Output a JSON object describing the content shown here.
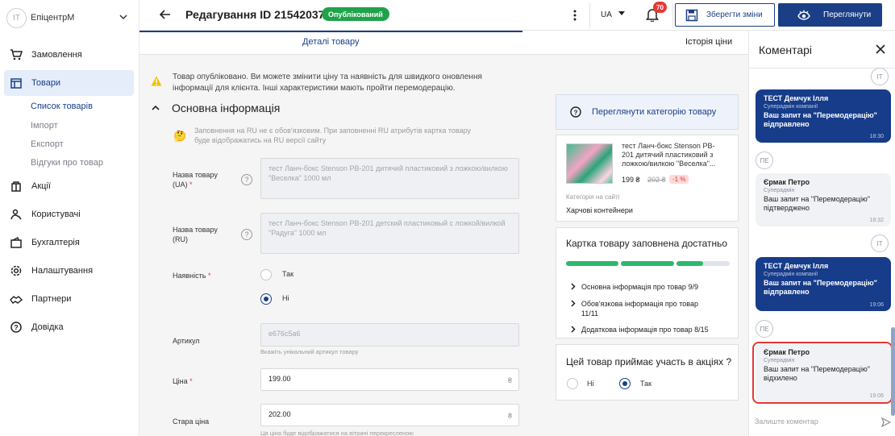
{
  "brand": {
    "avatar": "IT",
    "name": "ЕпіцентрМ"
  },
  "sidebar": {
    "items": [
      {
        "label": "Замовлення",
        "icon": "cart-icon"
      },
      {
        "label": "Товари",
        "icon": "store-icon",
        "active": true
      },
      {
        "label": "Акції",
        "icon": "promo-icon"
      },
      {
        "label": "Користувачі",
        "icon": "users-icon"
      },
      {
        "label": "Бухгалтерія",
        "icon": "wallet-icon"
      },
      {
        "label": "Налаштування",
        "icon": "gear-icon"
      },
      {
        "label": "Партнери",
        "icon": "handshake-icon"
      },
      {
        "label": "Довідка",
        "icon": "help-icon"
      }
    ],
    "subitems": [
      {
        "label": "Список товарів",
        "active": true
      },
      {
        "label": "Імпорт"
      },
      {
        "label": "Експорт"
      },
      {
        "label": "Відгуки про товар"
      }
    ]
  },
  "header": {
    "title": "Редагування ID 21542037",
    "status": "Опублікований",
    "lang": "UA",
    "notifications": "70",
    "save_label": "Зберегти зміни",
    "view_label": "Переглянути"
  },
  "tabs": [
    {
      "label": "Деталі товару",
      "active": true
    },
    {
      "label": "Історія ціни"
    }
  ],
  "main": {
    "warning": "Товар опубліковано. Ви можете змінити ціну та наявність для швидкого оновлення інформації для клієнта. Інші характеристики мають пройти перемодерацію.",
    "section_title": "Основна інформація",
    "note": "Заповнення на RU не є обов'язковим. При заповненні RU атрибутів картка товару буде відображатись на RU версії сайту",
    "name_ua_label": "Назва товару (UA)",
    "name_ua_value": "тест Ланч-бокс Stenson PB-201 дитячий пластиковий з ложкою/вилкою \"Веселка\" 1000 мл",
    "name_ru_label": "Назва товару (RU)",
    "name_ru_value": "тест Ланч-бокс Stenson PB-201 детский пластиковый с ложкой/вилкой \"Радуга\" 1000 мл",
    "availability_label": "Наявність",
    "availability_yes": "Так",
    "availability_no": "Ні",
    "availability_selected": "Ні",
    "sku_label": "Артикул",
    "sku_value": "e676c5a6",
    "sku_hint": "Вкажіть унікальний артикул товару",
    "price_label": "Ціна",
    "price_value": "199.00",
    "old_price_label": "Стара ціна",
    "old_price_value": "202.00",
    "currency": "₴",
    "old_price_hint": "Ця ціна буде відображатися на вітрині перекресленою",
    "required_mark": "*"
  },
  "right": {
    "view_category": "Переглянути категорію товару",
    "product_name": "тест Ланч-бокс Stenson PB-201 дитячий пластиковий з ложкою/вилкою \"Веселка\"...",
    "price": "199 ₴",
    "old_price": "202 ₴",
    "discount": "-1 %",
    "category_label": "Категорія на сайті",
    "category_value": "Харчові контейнери",
    "fill_title": "Картка товару заповнена достатньо",
    "fill_progress": [
      1,
      1,
      0.5
    ],
    "fill_rows": [
      "Основна інформація про товар 9/9",
      "Обов'язкова інформація про товар 11/11",
      "Додаткова інформація про товар 8/15"
    ],
    "promo_question": "Цей товар приймає участь в акціях ?",
    "promo_no": "Ні",
    "promo_yes": "Так",
    "promo_selected": "Так"
  },
  "comments": {
    "title": "Коментарі",
    "items": [
      {
        "avatar": "IT",
        "author": "ТЕСТ Демчук Ілля",
        "role": "Суперадмін компанії",
        "text": "Ваш запит на \"Перемодерацію\" відправлено",
        "time": "18:30",
        "mine": true
      },
      {
        "avatar": "ПЕ",
        "author": "Єрмак Петро",
        "role": "Суперадмін",
        "text": "Ваш запит на \"Перемодерацію\" підтверджено",
        "time": "18:32",
        "mine": false
      },
      {
        "avatar": "IT",
        "author": "ТЕСТ Демчук Ілля",
        "role": "Суперадмін компанії",
        "text": "Ваш запит на \"Перемодерацію\" відправлено",
        "time": "19:06",
        "mine": true
      },
      {
        "avatar": "ПЕ",
        "author": "Єрмак Петро",
        "role": "Суперадмін",
        "text": "Ваш запит на \"Перемодерацію\" відхилено",
        "time": "19:06",
        "mine": false
      }
    ],
    "placeholder": "Залиште коментар"
  }
}
